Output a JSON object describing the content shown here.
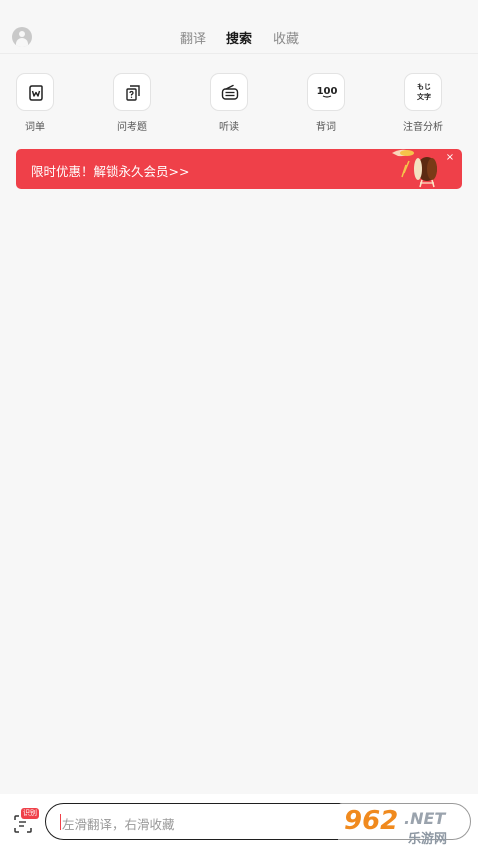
{
  "header": {
    "tabs": [
      {
        "label": "翻译",
        "active": false
      },
      {
        "label": "搜索",
        "active": true
      },
      {
        "label": "收藏",
        "active": false
      }
    ]
  },
  "shortcuts": [
    {
      "label": "词单",
      "icon": "wordlist-icon"
    },
    {
      "label": "问考题",
      "icon": "exam-question-icon"
    },
    {
      "label": "听读",
      "icon": "radio-icon"
    },
    {
      "label": "背词",
      "icon": "hundred-words-icon",
      "icon_text": "100"
    },
    {
      "label": "注音分析",
      "icon": "furigana-icon",
      "icon_text_top": "もじ",
      "icon_text_bottom": "文字"
    }
  ],
  "promo": {
    "text": "限时优惠！解锁永久会员>>",
    "close": "×"
  },
  "bottom": {
    "badge": "识别",
    "placeholder": "左滑翻译，右滑收藏"
  },
  "watermark": {
    "top": "962.NET",
    "bottom": "乐游网"
  },
  "colors": {
    "accent": "#ef4049",
    "background": "#f7f7f7",
    "tab_active": "#1a1a1a",
    "tab_inactive": "#8a8a8a"
  }
}
